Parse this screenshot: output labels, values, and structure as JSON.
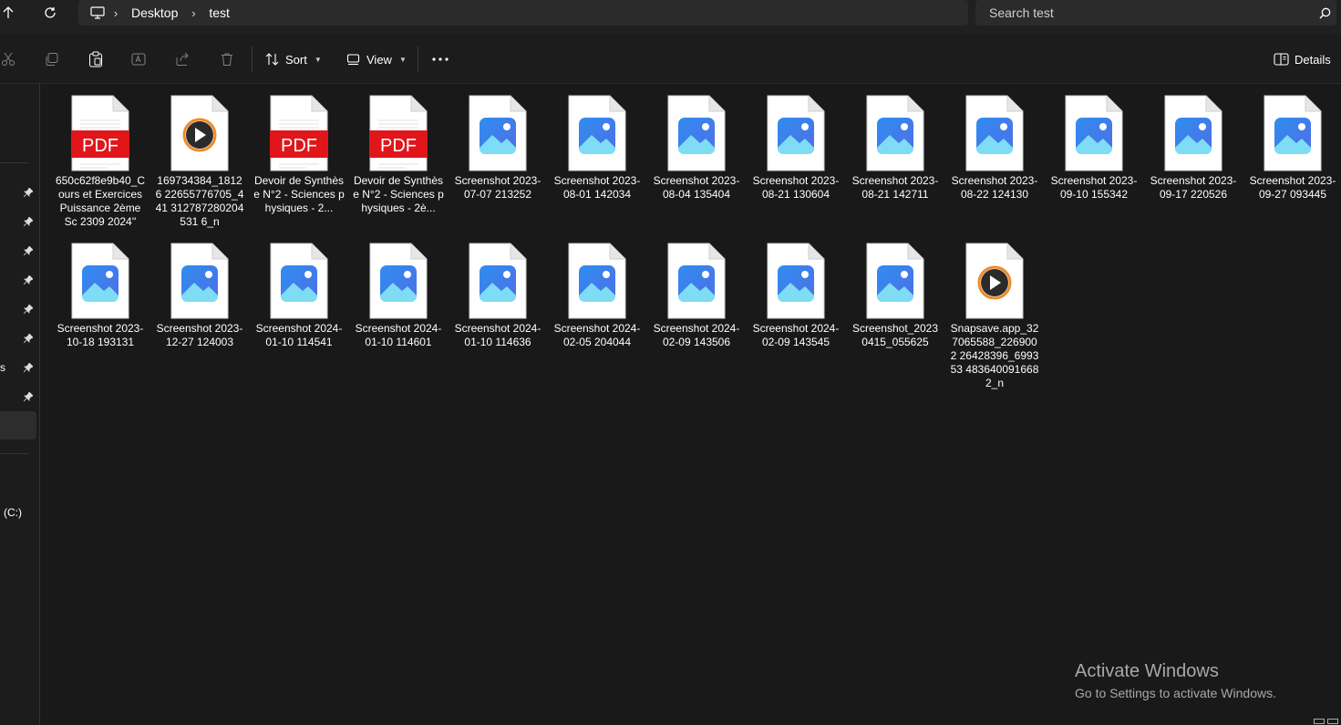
{
  "address_bar": {
    "breadcrumb": [
      "Desktop",
      "test"
    ],
    "search_placeholder": "Search test"
  },
  "command_bar": {
    "sort_label": "Sort",
    "view_label": "View",
    "details_label": "Details"
  },
  "sidebar": {
    "partial_s": "s",
    "drive_label": "(C:)"
  },
  "files": [
    {
      "name": "650c62f8e9b40_Cours et Exercices Puissance 2ème Sc 2309   2024''",
      "type": "pdf"
    },
    {
      "name": "169734384_18126 22655776705_441 312787280204531 6_n",
      "type": "video"
    },
    {
      "name": "Devoir de Synthèse N°2 - Sciences physiques - 2...",
      "type": "pdf"
    },
    {
      "name": "Devoir de Synthèse N°2 - Sciences physiques - 2è...",
      "type": "pdf"
    },
    {
      "name": "Screenshot 2023-07-07 213252",
      "type": "image"
    },
    {
      "name": "Screenshot 2023-08-01 142034",
      "type": "image"
    },
    {
      "name": "Screenshot 2023-08-04 135404",
      "type": "image"
    },
    {
      "name": "Screenshot 2023-08-21 130604",
      "type": "image"
    },
    {
      "name": "Screenshot 2023-08-21 142711",
      "type": "image"
    },
    {
      "name": "Screenshot 2023-08-22 124130",
      "type": "image"
    },
    {
      "name": "Screenshot 2023-09-10 155342",
      "type": "image"
    },
    {
      "name": "Screenshot 2023-09-17 220526",
      "type": "image"
    },
    {
      "name": "Screenshot 2023-09-27 093445",
      "type": "image"
    },
    {
      "name": "Screenshot 2023-10-18 193131",
      "type": "image"
    },
    {
      "name": "Screenshot 2023-12-27 124003",
      "type": "image"
    },
    {
      "name": "Screenshot 2024-01-10 114541",
      "type": "image"
    },
    {
      "name": "Screenshot 2024-01-10 114601",
      "type": "image"
    },
    {
      "name": "Screenshot 2024-01-10 114636",
      "type": "image"
    },
    {
      "name": "Screenshot 2024-02-05 204044",
      "type": "image"
    },
    {
      "name": "Screenshot 2024-02-09 143506",
      "type": "image"
    },
    {
      "name": "Screenshot 2024-02-09 143545",
      "type": "image"
    },
    {
      "name": "Screenshot_2023 0415_055625",
      "type": "image"
    },
    {
      "name": "Snapsave.app_32 7065588_2269002 26428396_699353 4836400916682_n",
      "type": "video"
    }
  ],
  "watermark": {
    "title": "Activate Windows",
    "subtitle": "Go to Settings to activate Windows."
  },
  "colors": {
    "background": "#191919",
    "pdf_red": "#e0161b",
    "image_blue": "#1e88e5",
    "video_orange": "#f08a24"
  }
}
